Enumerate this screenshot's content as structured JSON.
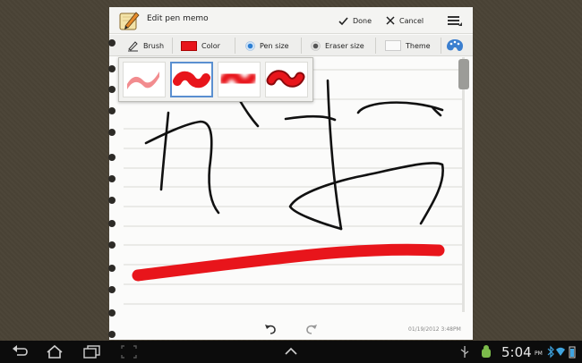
{
  "titlebar": {
    "title": "Edit pen memo",
    "done_label": "Done",
    "cancel_label": "Cancel"
  },
  "toolbar": {
    "brush_label": "Brush",
    "color_label": "Color",
    "pen_size_label": "Pen size",
    "eraser_size_label": "Eraser size",
    "theme_label": "Theme",
    "current_color": "#e8151b"
  },
  "brush_popup": {
    "options": [
      "soft-marker",
      "round-marker",
      "airbrush",
      "ink-pen"
    ],
    "selected_index": 1
  },
  "memo": {
    "timestamp": "01/19/2012 3:48PM"
  },
  "statusbar": {
    "time": "5:04",
    "ampm": "PM"
  },
  "icons": {
    "back": "back-icon",
    "home": "home-icon",
    "recent": "recent-apps-icon",
    "screenshot": "screenshot-icon",
    "up": "chevron-up-icon",
    "usb": "usb-icon",
    "debug": "android-debug-icon",
    "bluetooth": "bluetooth-icon",
    "wifi": "wifi-icon",
    "battery": "battery-icon"
  }
}
